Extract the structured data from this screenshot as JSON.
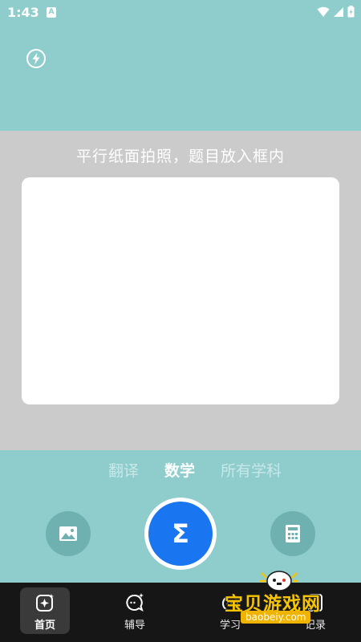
{
  "status_bar": {
    "time": "1:43",
    "badge": "A"
  },
  "camera": {
    "hint": "平行纸面拍照，题目放入框内"
  },
  "subjects": {
    "items": [
      {
        "label": "翻译",
        "active": false
      },
      {
        "label": "数学",
        "active": true
      },
      {
        "label": "所有学科",
        "active": false
      }
    ]
  },
  "shutter": {
    "symbol": "Σ"
  },
  "icons": {
    "flash": "flash-auto-icon",
    "left_button": "gallery-image-icon",
    "right_button": "calculator-icon",
    "shutter": "sigma-icon"
  },
  "nav": {
    "items": [
      {
        "label": "首页",
        "icon": "home-sparkle-icon",
        "active": true
      },
      {
        "label": "辅导",
        "icon": "chat-sparkle-icon",
        "active": false
      },
      {
        "label": "学习",
        "icon": "study-icon",
        "active": false
      },
      {
        "label": "记录",
        "icon": "record-icon",
        "active": false
      }
    ]
  },
  "watermark": {
    "title": "宝贝游戏网",
    "url": "baobeiy.com"
  },
  "colors": {
    "accent": "#1976f0",
    "top_bg": "#8fcdcd",
    "camera_bg": "#cbcbcb",
    "nav_bg": "#161616"
  }
}
